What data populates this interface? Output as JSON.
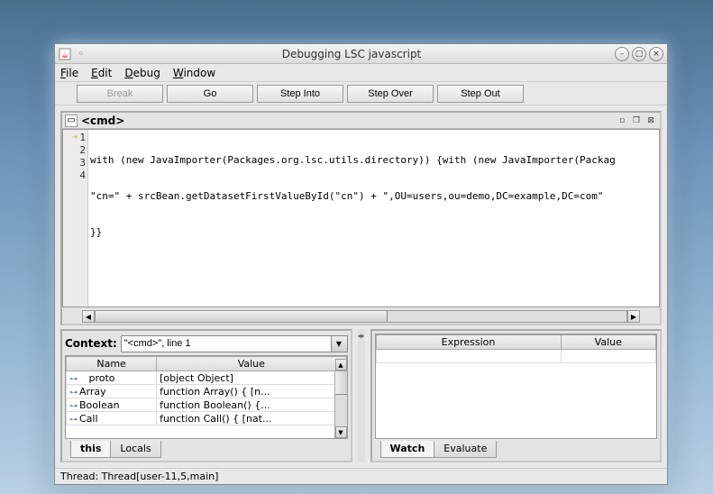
{
  "window": {
    "title": "Debugging LSC javascript"
  },
  "menu": {
    "file": "File",
    "edit": "Edit",
    "debug": "Debug",
    "window": "Window"
  },
  "toolbar": {
    "break": "Break",
    "go": "Go",
    "step_into": "Step Into",
    "step_over": "Step Over",
    "step_out": "Step Out"
  },
  "editor": {
    "title": "<cmd>",
    "lines": {
      "l1": "with (new JavaImporter(Packages.org.lsc.utils.directory)) {with (new JavaImporter(Packag",
      "l2": "\"cn=\" + srcBean.getDatasetFirstValueById(\"cn\") + \",OU=users,ou=demo,DC=example,DC=com\"",
      "l3": "}}",
      "l4": ""
    },
    "gutter": {
      "n1": "1",
      "n2": "2",
      "n3": "3",
      "n4": "4"
    }
  },
  "context": {
    "label": "Context:",
    "value": "\"<cmd>\", line 1"
  },
  "vars_table": {
    "headers": {
      "name": "Name",
      "value": "Value"
    },
    "rows": [
      {
        "name": "proto",
        "value": "[object Object]"
      },
      {
        "name": "Array",
        "value": "function Array() { [n..."
      },
      {
        "name": "Boolean",
        "value": "function Boolean() {..."
      },
      {
        "name": "Call",
        "value": "function Call() { [nat..."
      }
    ],
    "tabs": {
      "this": "this",
      "locals": "Locals"
    }
  },
  "watch_table": {
    "headers": {
      "expr": "Expression",
      "value": "Value"
    },
    "tabs": {
      "watch": "Watch",
      "evaluate": "Evaluate"
    }
  },
  "status": "Thread: Thread[user-11,5,main]"
}
